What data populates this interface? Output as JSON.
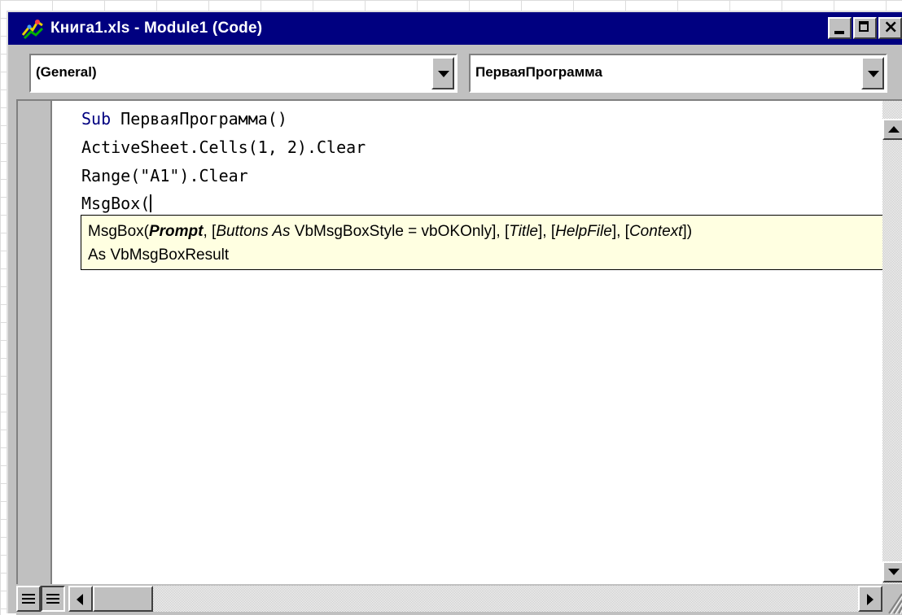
{
  "window": {
    "title": "Книга1.xls - Module1 (Code)",
    "icon": "vba-module-icon",
    "title_bar_color": "#000080",
    "face_color": "#c0c0c0"
  },
  "object_combo": {
    "value": "(General)"
  },
  "procedure_combo": {
    "value": "ПерваяПрограмма"
  },
  "code": {
    "line1": {
      "keyword": "Sub",
      "rest": " ПерваяПрограмма()"
    },
    "line2": "ActiveSheet.Cells(1, 2).Clear",
    "line3": "Range(\"A1\").Clear",
    "line4": "MsgBox(",
    "keyword_color": "#000080"
  },
  "tooltip": {
    "func": "MsgBox(",
    "prompt": "Prompt",
    "sep1": ", [",
    "buttons": "Buttons As",
    "buttons_rest": " VbMsgBoxStyle = vbOKOnly], [",
    "title": "Title",
    "sep2": "], [",
    "helpfile": "HelpFile",
    "sep3": "], [",
    "context": "Context",
    "close": "])",
    "return_line": "As VbMsgBoxResult",
    "background": "#ffffe1"
  }
}
